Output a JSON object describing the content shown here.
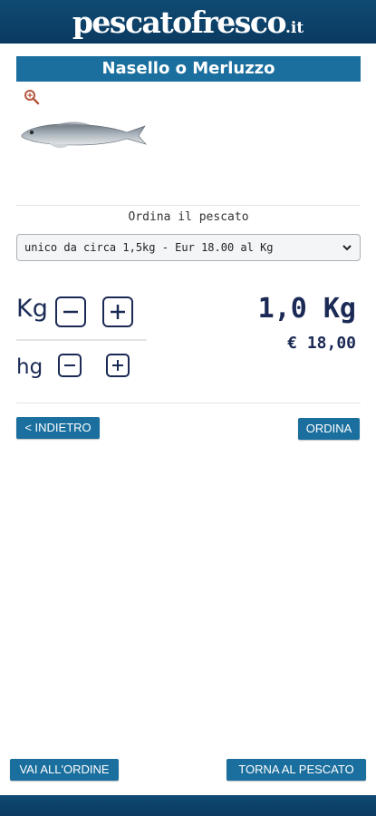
{
  "header": {
    "logo_main": "pescatofresco",
    "logo_tld": ".it"
  },
  "product": {
    "title": "Nasello o Merluzzo"
  },
  "order": {
    "label": "Ordina il pescato",
    "selected_option": "unico da circa 1,5kg - Eur 18.00 al Kg"
  },
  "quantity": {
    "kg_label": "Kg",
    "hg_label": "hg",
    "total": "1,0 Kg",
    "price": "€ 18,00"
  },
  "buttons": {
    "back": "< INDIETRO",
    "order": "ORDINA",
    "go_to_order": "VAI ALL'ORDINE",
    "back_to_catch": "TORNA AL PESCATO"
  },
  "colors": {
    "brand_dark": "#0b3a60",
    "accent": "#1b6f9e",
    "text": "#1b2a55"
  },
  "icons": [
    "zoom-icon",
    "minus-icon",
    "plus-icon",
    "chevron-down-icon"
  ]
}
